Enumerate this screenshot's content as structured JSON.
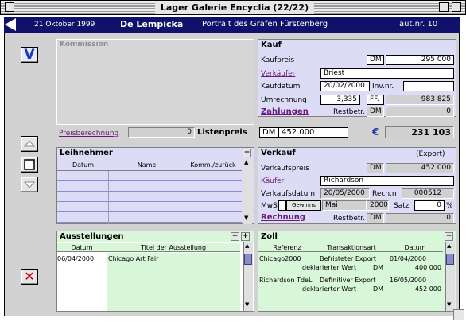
{
  "window": {
    "title": "Lager Galerie Encyclia (22/22)"
  },
  "header": {
    "date": "21 Oktober 1999",
    "artist": "De Lempicka",
    "work": "Portrait des Grafen Fürstenberg",
    "aut": "aut.nr. 10"
  },
  "left_buttons": {
    "v_label": "V",
    "x_label": "✕"
  },
  "kommission": {
    "title": "Kommission"
  },
  "kauf": {
    "title": "Kauf",
    "kaufpreis_label": "Kaufpreis",
    "currency": "DM",
    "kaufpreis": "295 000",
    "verkaeufer_label": "Verkäufer",
    "verkaeufer": "Briest",
    "kaufdatum_label": "Kaufdatum",
    "kaufdatum": "20/02/2000",
    "invnr_label": "Inv.nr.",
    "invnr": "",
    "umrechnung_label": "Umrechnung",
    "umrechnung": "3,335",
    "ff": "FF.",
    "umrechnung_value": "983 825",
    "zahlungen_label": "Zahlungen",
    "restbetr_label": "Restbetr.",
    "restbetr_cur": "DM",
    "restbetr": "0"
  },
  "preis": {
    "berechnung_label": "Preisberechnung",
    "berechnung_value": "0",
    "listenpreis_label": "Listenpreis",
    "listenpreis_cur": "DM",
    "listenpreis": "452 000",
    "euro_symbol": "€",
    "euro_value": "231 103"
  },
  "leihnehmer": {
    "title": "Leihnehmer",
    "add": "+",
    "columns": [
      "Datum",
      "Name",
      "Komm./zurück"
    ]
  },
  "verkauf": {
    "title": "Verkauf",
    "type": "(Export)",
    "preis_label": "Verkaufspreis",
    "currency": "DM",
    "preis": "452 000",
    "kaeufer_label": "Käufer",
    "kaeufer": "Richardson",
    "datum_label": "Verkaufsdatum",
    "datum": "20/05/2000",
    "rechn_label": "Rech.n",
    "rechn": "000512",
    "mwst_label": "MwSt",
    "gewinns_label": "Gewinns",
    "month": "Mai",
    "year": "2000",
    "satz_label": "Satz",
    "satz": "0",
    "percent": "%",
    "rechnung_label": "Rechnung",
    "restbetr_label": "Restbetr.",
    "restbetr_cur": "DM",
    "restbetr": "0"
  },
  "ausstellungen": {
    "title": "Ausstellungen",
    "columns": [
      "Datum",
      "Titel der Ausstellung"
    ],
    "rows": [
      {
        "datum": "06/04/2000",
        "titel": "Chicago Art Fair"
      }
    ]
  },
  "zoll": {
    "title": "Zoll",
    "add": "+",
    "columns": [
      "Referenz",
      "Transaktionsart",
      "Datum"
    ],
    "rows": [
      {
        "ref": "Chicago2000",
        "art": "Befristeter Export",
        "datum": "01/04/2000",
        "wert_label": "deklarierter Wert",
        "wert_cur": "DM",
        "wert": "400 000"
      },
      {
        "ref": "Richardson TdeL",
        "art": "Definitiver Export",
        "datum": "16/05/2000",
        "wert_label": "deklarierter Wert",
        "wert_cur": "DM",
        "wert": "452 000"
      }
    ]
  }
}
